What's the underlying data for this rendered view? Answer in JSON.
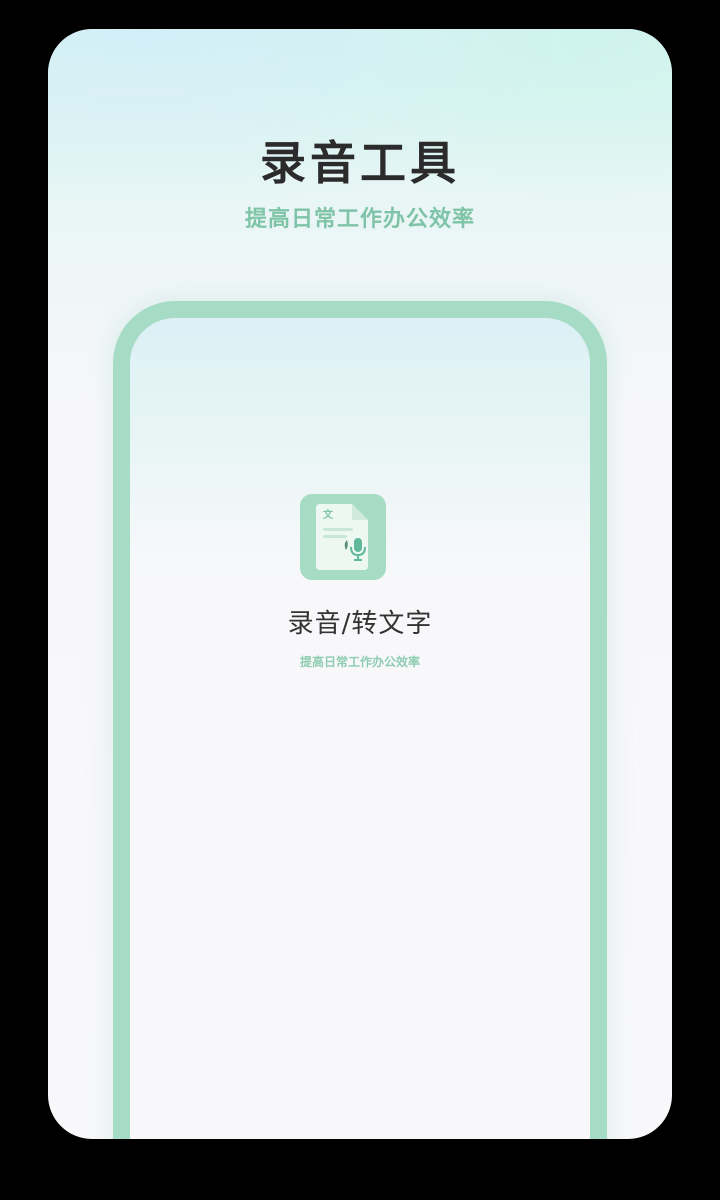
{
  "header": {
    "title": "录音工具",
    "subtitle": "提高日常工作办公效率"
  },
  "app": {
    "icon": "document-microphone-icon",
    "icon_glyph": "文",
    "name": "录音/转文字",
    "description": "提高日常工作办公效率"
  },
  "colors": {
    "accent": "#a6dcc6",
    "accent_text": "#7fc4a8",
    "title_text": "#2b2b2b",
    "background": "#000000"
  }
}
